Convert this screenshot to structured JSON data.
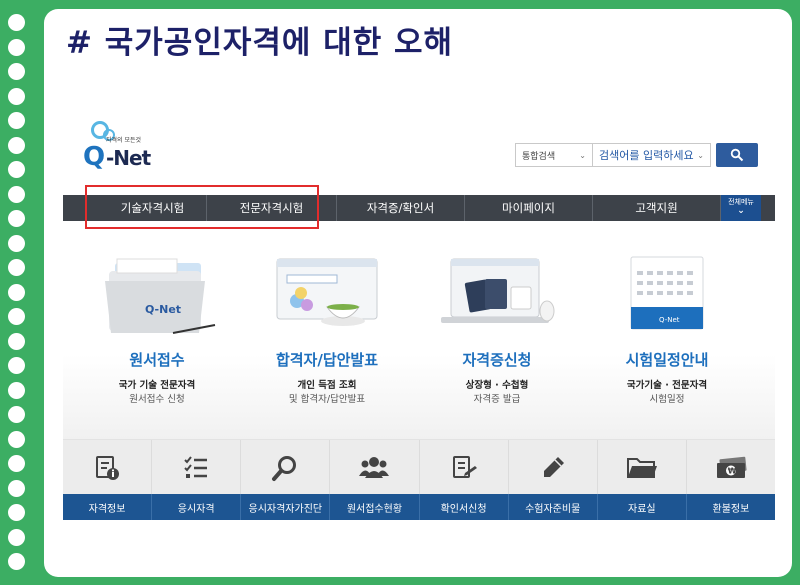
{
  "slide": {
    "title": "# 국가공인자격에 대한 오해"
  },
  "site": {
    "logo": {
      "tagline": "자격의 모든것",
      "q": "Q",
      "name": "-Net"
    },
    "search": {
      "scope": "통합검색",
      "placeholder": "검색어를 입력하세요"
    },
    "nav": {
      "items": [
        "기술자격시험",
        "전문자격시험",
        "자격증/확인서",
        "마이페이지",
        "고객지원"
      ],
      "all_menu": "전체메뉴"
    },
    "services": [
      {
        "title": "원서접수",
        "sub1": "국가 기술 전문자격",
        "sub2": "원서접수 신청"
      },
      {
        "title": "합격자/답안발표",
        "sub1": "개인 득점 조회",
        "sub2": "및 합격자/답안발표"
      },
      {
        "title": "자격증신청",
        "sub1": "상장형 · 수첩형",
        "sub2": "자격증 발급"
      },
      {
        "title": "시험일정안내",
        "sub1": "국가기술 · 전문자격",
        "sub2": "시험일정"
      }
    ],
    "quick_menu": [
      "자격정보",
      "응시자격",
      "응시자격자가진단",
      "원서접수현황",
      "확인서신청",
      "수험자준비물",
      "자료실",
      "환불정보"
    ],
    "quick_icons": [
      "info-doc-icon",
      "checklist-icon",
      "magnifier-icon",
      "people-icon",
      "certificate-icon",
      "pencil-icon",
      "folder-icon",
      "banknote-icon"
    ]
  }
}
